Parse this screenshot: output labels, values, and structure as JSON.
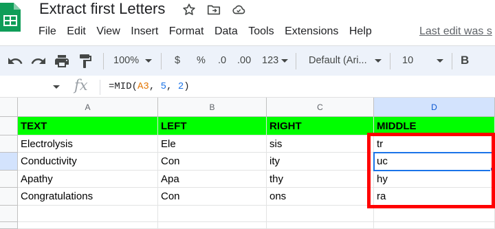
{
  "app": {
    "doc_title": "Extract first Letters",
    "menu": [
      "File",
      "Edit",
      "View",
      "Insert",
      "Format",
      "Data",
      "Tools",
      "Extensions",
      "Help"
    ],
    "last_edit": "Last edit was s"
  },
  "toolbar": {
    "zoom": "100%",
    "currency": "$",
    "percent": "%",
    "decrease_decimal": ".0",
    "increase_decimal": ".00",
    "more_formats": "123",
    "font": "Default (Ari...",
    "font_size": "10",
    "bold": "B"
  },
  "formula_bar": {
    "fx": "fx",
    "formula_prefix": "=MID(",
    "formula_ref": "A3",
    "formula_sep1": ", ",
    "formula_num1": "5",
    "formula_sep2": ", ",
    "formula_num2": "2",
    "formula_suffix": ")"
  },
  "grid": {
    "columns": [
      "A",
      "B",
      "C",
      "D"
    ],
    "header_row": [
      "TEXT",
      "LEFT",
      "RIGHT",
      "MIDDLE"
    ],
    "rows": [
      [
        "Electrolysis",
        "Ele",
        "sis",
        "tr"
      ],
      [
        "Conductivity",
        "Con",
        "ity",
        "uc"
      ],
      [
        "Apathy",
        "Apa",
        "thy",
        "hy"
      ],
      [
        "Congratulations",
        "Con",
        "ons",
        "ra"
      ]
    ]
  },
  "colors": {
    "header_fill": "#00ff00",
    "highlight_border": "#ff0000",
    "selection": "#1a73e8"
  }
}
